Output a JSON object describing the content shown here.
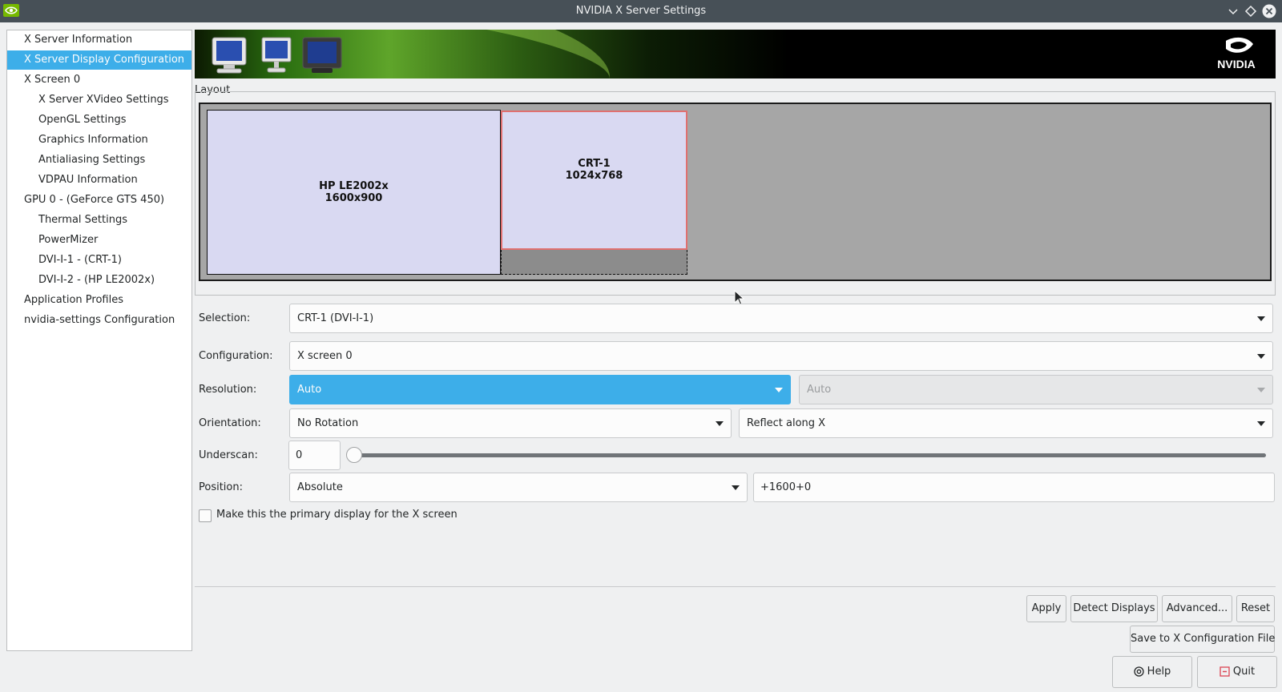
{
  "window": {
    "title": "NVIDIA X Server Settings"
  },
  "sidebar": {
    "items": [
      {
        "label": "X Server Information",
        "indent": 0,
        "selected": false
      },
      {
        "label": "X Server Display Configuration",
        "indent": 0,
        "selected": true
      },
      {
        "label": "X Screen 0",
        "indent": 0,
        "selected": false
      },
      {
        "label": "X Server XVideo Settings",
        "indent": 1,
        "selected": false
      },
      {
        "label": "OpenGL Settings",
        "indent": 1,
        "selected": false
      },
      {
        "label": "Graphics Information",
        "indent": 1,
        "selected": false
      },
      {
        "label": "Antialiasing Settings",
        "indent": 1,
        "selected": false
      },
      {
        "label": "VDPAU Information",
        "indent": 1,
        "selected": false
      },
      {
        "label": "GPU 0 - (GeForce GTS 450)",
        "indent": 0,
        "selected": false
      },
      {
        "label": "Thermal Settings",
        "indent": 1,
        "selected": false
      },
      {
        "label": "PowerMizer",
        "indent": 1,
        "selected": false
      },
      {
        "label": "DVI-I-1 - (CRT-1)",
        "indent": 1,
        "selected": false
      },
      {
        "label": "DVI-I-2 - (HP LE2002x)",
        "indent": 1,
        "selected": false
      },
      {
        "label": "Application Profiles",
        "indent": 0,
        "selected": false
      },
      {
        "label": "nvidia-settings Configuration",
        "indent": 0,
        "selected": false
      }
    ]
  },
  "layout": {
    "label": "Layout",
    "displays": [
      {
        "name": "HP LE2002x",
        "mode": "1600x900"
      },
      {
        "name": "CRT-1",
        "mode": "1024x768",
        "selected": true
      }
    ]
  },
  "form": {
    "selection": {
      "label": "Selection:",
      "value": "CRT-1 (DVI-I-1)"
    },
    "configuration": {
      "label": "Configuration:",
      "value": "X screen 0"
    },
    "resolution": {
      "label": "Resolution:",
      "value": "Auto",
      "refresh_value": "Auto"
    },
    "orientation": {
      "label": "Orientation:",
      "rotation_value": "No Rotation",
      "reflection_value": "Reflect along X"
    },
    "underscan": {
      "label": "Underscan:",
      "value": "0",
      "slider_fraction": 0
    },
    "position": {
      "label": "Position:",
      "type_value": "Absolute",
      "offset_value": "+1600+0"
    },
    "primary_checkbox": {
      "label": "Make this the primary display for the X screen",
      "checked": false
    }
  },
  "buttons": {
    "apply": "Apply",
    "detect": "Detect Displays",
    "advanced": "Advanced...",
    "reset": "Reset",
    "save": "Save to X Configuration File",
    "help": "Help",
    "quit": "Quit"
  },
  "colors": {
    "accent": "#3daee9",
    "titlebar": "#475057",
    "display_fill": "#d9d9f2",
    "selected_display_border": "#e07070",
    "nvidia_green": "#76b900"
  }
}
